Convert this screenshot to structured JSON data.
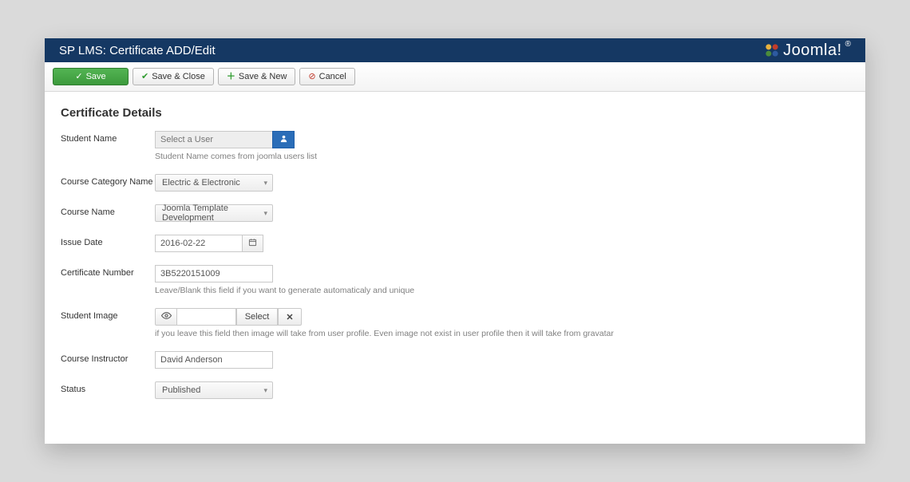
{
  "header": {
    "title": "SP LMS: Certificate ADD/Edit",
    "brand_text": "Joomla!",
    "brand_reg": "®"
  },
  "toolbar": {
    "save": "Save",
    "save_close": "Save & Close",
    "save_new": "Save & New",
    "cancel": "Cancel"
  },
  "section_title": "Certificate Details",
  "fields": {
    "student_name": {
      "label": "Student Name",
      "placeholder": "Select a User",
      "help": "Student Name comes from joomla users list"
    },
    "course_category": {
      "label": "Course Category Name",
      "value": "Electric & Electronic"
    },
    "course_name": {
      "label": "Course Name",
      "value": "Joomla Template Development"
    },
    "issue_date": {
      "label": "Issue Date",
      "value": "2016-02-22"
    },
    "cert_number": {
      "label": "Certificate Number",
      "value": "3B5220151009",
      "help": "Leave/Blank this field if you want to generate automaticaly and unique"
    },
    "student_image": {
      "label": "Student Image",
      "select_label": "Select",
      "help": "if you leave this field then image will take from user profile. Even image not exist in user profile then it will take from gravatar"
    },
    "instructor": {
      "label": "Course Instructor",
      "value": "David Anderson"
    },
    "status": {
      "label": "Status",
      "value": "Published"
    }
  }
}
